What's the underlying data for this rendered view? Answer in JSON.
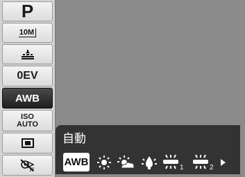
{
  "sidebar": {
    "mode": "P",
    "resolution": "10M",
    "exposure": "0EV",
    "white_balance": "AWB",
    "iso_line1": "ISO",
    "iso_line2": "AUTO"
  },
  "option_panel": {
    "title": "自動",
    "selected_label": "AWB",
    "options": [
      "awb-icon",
      "sun-icon",
      "cloudy-icon",
      "tungsten-icon",
      "fluorescent-1-icon",
      "fluorescent-2-icon"
    ],
    "fluor1_sub": "1",
    "fluor2_sub": "2"
  },
  "colors": {
    "selected_bg": "#2a2a2a",
    "panel_bg": "#333333",
    "sidebar_bg": "#d2d2d2",
    "viewfinder": "#8b8b8b"
  }
}
